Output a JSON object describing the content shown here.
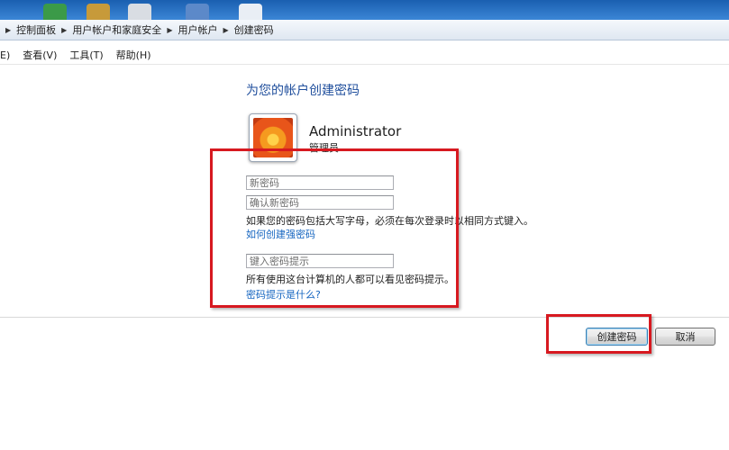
{
  "breadcrumb": {
    "items": [
      "控制面板",
      "用户帐户和家庭安全",
      "用户帐户",
      "创建密码"
    ]
  },
  "menu": {
    "partial_first": "E)",
    "items": [
      "查看(V)",
      "工具(T)",
      "帮助(H)"
    ]
  },
  "page": {
    "title": "为您的帐户创建密码"
  },
  "user": {
    "name": "Administrator",
    "role": "管理员"
  },
  "form": {
    "new_password_placeholder": "新密码",
    "confirm_password_placeholder": "确认新密码",
    "case_note": "如果您的密码包括大写字母，必须在每次登录时以相同方式键入。",
    "strong_password_link": "如何创建强密码",
    "hint_placeholder": "键入密码提示",
    "hint_note": "所有使用这台计算机的人都可以看见密码提示。",
    "hint_help_link": "密码提示是什么?"
  },
  "buttons": {
    "create": "创建密码",
    "cancel": "取消"
  },
  "colors": {
    "title": "#1f4e9c",
    "link": "#1565c0",
    "highlight": "#d71920"
  }
}
